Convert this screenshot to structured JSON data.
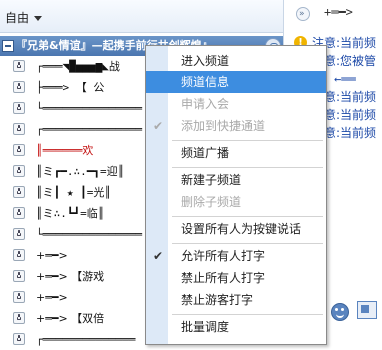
{
  "toolbar": {
    "mode_label": "自由"
  },
  "channel": {
    "name": "『兄弟&情谊』—起携手前行共创辉煌』"
  },
  "tree_rows": [
    {
      "text": "┌═══◥█▅▅▅▆◣战",
      "color": "#111"
    },
    {
      "text": "├═══>   【 公 ",
      "color": "#111"
    },
    {
      "text": "└═══════════════",
      "color": "#111"
    },
    {
      "text": "┌═══════════════",
      "color": "#111"
    },
    {
      "text": "║══════欢",
      "color": "#c41313"
    },
    {
      "text": "║ミ┏━.∴.━┓=迎║",
      "color": "#111"
    },
    {
      "text": "║ミ┃ ★ ┃=光║",
      "color": "#111"
    },
    {
      "text": "║ミ∴.┗┛=临║",
      "color": "#111"
    },
    {
      "text": "└═══════════════",
      "color": "#111"
    }
  ],
  "plain_rows": [
    {
      "text": "+═━>"
    },
    {
      "text": "+═━>       【游戏"
    },
    {
      "text": "+═━>"
    },
    {
      "text": "+═━>       【双倍"
    },
    {
      "text": "┌══════════════"
    }
  ],
  "right_panel": {
    "top_arrow": "+═━>",
    "notes": [
      {
        "key": "注意:",
        "value": "当前频"
      },
      {
        "key": "注意:",
        "value": "您被管"
      },
      {
        "key": "",
        "value": "←══"
      },
      {
        "key": "注意:",
        "value": "当前频"
      },
      {
        "key": "注意:",
        "value": "当前频"
      },
      {
        "key": "注意:",
        "value": "当前频"
      }
    ]
  },
  "context_menu": {
    "items": [
      {
        "label": "进入频道",
        "disabled": false,
        "checked": false,
        "selected": false
      },
      {
        "label": "频道信息",
        "disabled": false,
        "checked": false,
        "selected": true
      },
      {
        "label": "申请入会",
        "disabled": true,
        "checked": false,
        "selected": false
      },
      {
        "label": "添加到快捷通道",
        "disabled": true,
        "checked": true,
        "selected": false
      },
      {
        "label": "频道广播",
        "disabled": false,
        "checked": false,
        "selected": false
      },
      {
        "label": "新建子频道",
        "disabled": false,
        "checked": false,
        "selected": false
      },
      {
        "label": "删除子频道",
        "disabled": true,
        "checked": false,
        "selected": false
      },
      {
        "label": "设置所有人为按键说话",
        "disabled": false,
        "checked": false,
        "selected": false
      },
      {
        "label": "允许所有人打字",
        "disabled": false,
        "checked": true,
        "selected": false
      },
      {
        "label": "禁止所有人打字",
        "disabled": false,
        "checked": false,
        "selected": false
      },
      {
        "label": "禁止游客打字",
        "disabled": false,
        "checked": false,
        "selected": false
      },
      {
        "label": "批量调度",
        "disabled": false,
        "checked": false,
        "selected": false
      }
    ],
    "checkmark_glyph": "✔"
  }
}
